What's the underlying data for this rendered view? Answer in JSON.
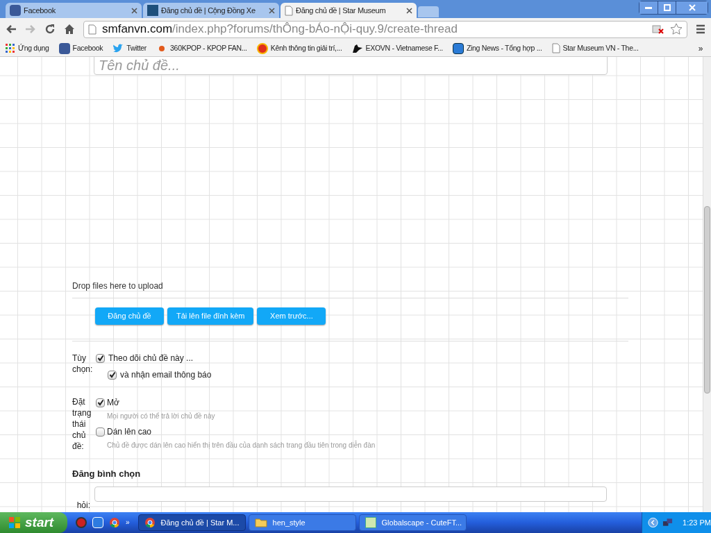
{
  "tabs": [
    {
      "title": "Facebook",
      "selected": false
    },
    {
      "title": "Đăng chủ đề | Cộng Đồng Xe",
      "selected": false
    },
    {
      "title": "Đăng chủ đề | Star Museum",
      "selected": true
    }
  ],
  "address": {
    "host": "smfanvn.com",
    "path": "/index.php?forums/thÔng-bÁo-nỘi-quy.9/create-thread"
  },
  "bookmarks": [
    "Ứng dụng",
    "Facebook",
    "Twitter",
    "360KPOP - KPOP FAN...",
    "Kênh thông tin giải trí,...",
    "EXOVN - Vietnamese F...",
    "Zing News - Tổng hợp ...",
    "Star Museum VN - The..."
  ],
  "bookmarks_more": "»",
  "title_field": {
    "placeholder": "Tên chủ đề..."
  },
  "drop_text": "Drop files here to upload",
  "buttons": [
    "Đăng chủ đề",
    "Tải lên file đính kèm",
    "Xem trước..."
  ],
  "options": {
    "label": "Tùy chọn:",
    "items": [
      {
        "label": "Theo dõi chủ đề này ...",
        "checked": true,
        "nested": false
      },
      {
        "label": "và nhận email thông báo",
        "checked": true,
        "nested": true
      }
    ]
  },
  "status": {
    "label": "Đặt trạng thái chủ đề:",
    "items": [
      {
        "label": "Mở",
        "hint": "Mọi người có thể trả lời chủ đề này",
        "checked": true
      },
      {
        "label": "Dán lên cao",
        "hint": "Chủ đề được dán lên cao hiển thị trên đầu của danh sách trang đầu tiên trong diễn đàn",
        "checked": false
      }
    ]
  },
  "poll": {
    "heading": "Đăng bình chọn",
    "question_label": "hỏi:"
  },
  "taskbar": {
    "start": "start",
    "windows": [
      {
        "title": "Đăng chủ đề | Star M...",
        "selected": true
      },
      {
        "title": "hen_style",
        "selected": false
      },
      {
        "title": "Globalscape - CuteFT...",
        "selected": false
      }
    ],
    "more": "»",
    "clock": "1:23 PM"
  }
}
